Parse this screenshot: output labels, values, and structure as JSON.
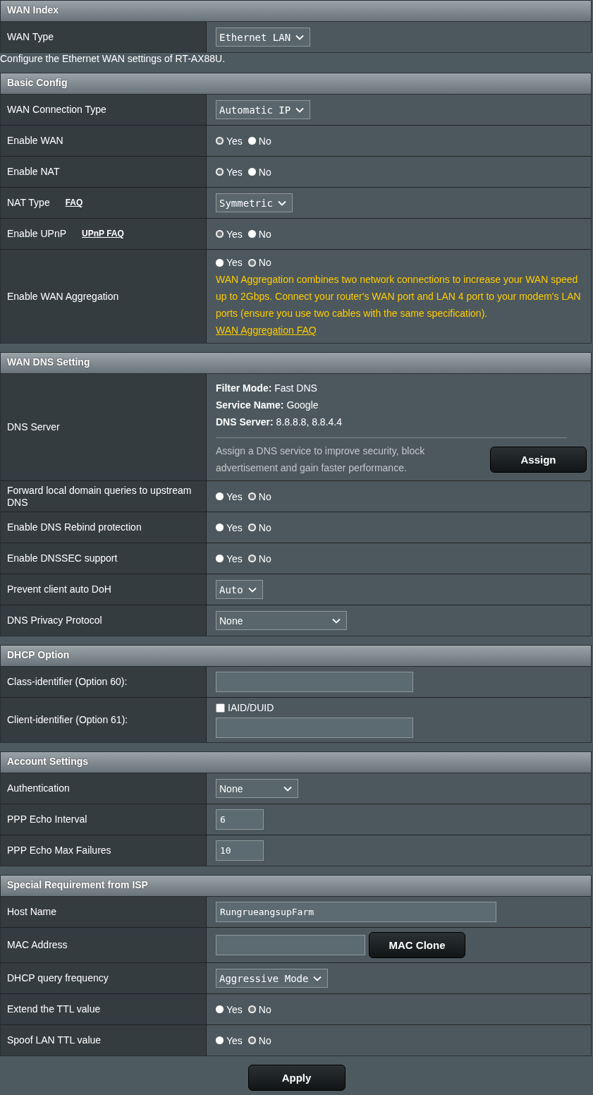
{
  "blocks": [
    {
      "kind": "section",
      "title": "WAN Index",
      "rows": [
        {
          "kind": "select",
          "label": "WAN Type",
          "value": "Ethernet LAN"
        }
      ]
    },
    {
      "kind": "note",
      "text": "Configure the Ethernet WAN settings of RT-AX88U."
    },
    {
      "kind": "section",
      "title": "Basic Config",
      "rows": [
        {
          "kind": "select",
          "label": "WAN Connection Type",
          "value": "Automatic IP"
        },
        {
          "kind": "radio",
          "label": "Enable WAN",
          "options": [
            {
              "label": "Yes",
              "selected": true
            },
            {
              "label": "No",
              "selected": false
            }
          ]
        },
        {
          "kind": "radio",
          "label": "Enable NAT",
          "options": [
            {
              "label": "Yes",
              "selected": true
            },
            {
              "label": "No",
              "selected": false
            }
          ]
        },
        {
          "kind": "select",
          "label": "NAT Type",
          "link": "FAQ",
          "value": "Symmetric"
        },
        {
          "kind": "radio",
          "label": "Enable UPnP",
          "link": "UPnP  FAQ",
          "options": [
            {
              "label": "Yes",
              "selected": true
            },
            {
              "label": "No",
              "selected": false
            }
          ]
        },
        {
          "kind": "radio",
          "label": "Enable WAN Aggregation",
          "options": [
            {
              "label": "Yes",
              "selected": false
            },
            {
              "label": "No",
              "selected": true
            }
          ],
          "note": "WAN Aggregation combines two network connections to increase your WAN speed up to 2Gbps. Connect your router's WAN port and LAN 4 port to your modem's LAN ports (ensure you use two cables with the same specification).",
          "note_link": "WAN Aggregation FAQ"
        }
      ]
    },
    {
      "kind": "section",
      "title": "WAN DNS Setting",
      "rows": [
        {
          "kind": "dns",
          "label": "DNS Server",
          "lines": [
            "**Filter Mode:** Fast DNS",
            "**Service Name:** Google",
            "**DNS Server:** 8.8.8.8, 8.8.4.4"
          ],
          "hint": "Assign a DNS service to improve security, block advertisement and gain faster performance.",
          "button": "Assign"
        },
        {
          "kind": "radio",
          "label": "Forward local domain queries to upstream DNS",
          "options": [
            {
              "label": "Yes",
              "selected": false
            },
            {
              "label": "No",
              "selected": true
            }
          ]
        },
        {
          "kind": "radio",
          "label": "Enable DNS Rebind protection",
          "options": [
            {
              "label": "Yes",
              "selected": false
            },
            {
              "label": "No",
              "selected": true
            }
          ]
        },
        {
          "kind": "radio",
          "label": "Enable DNSSEC support",
          "options": [
            {
              "label": "Yes",
              "selected": false
            },
            {
              "label": "No",
              "selected": true
            }
          ]
        },
        {
          "kind": "select",
          "label": "Prevent client auto DoH",
          "value": "Auto"
        },
        {
          "kind": "wide_select",
          "label": "DNS Privacy Protocol",
          "value": "None"
        }
      ]
    },
    {
      "kind": "section",
      "title": "DHCP Option",
      "rows": [
        {
          "kind": "text",
          "label": "Class-identifier (Option 60):"
        },
        {
          "kind": "check_text",
          "label": "Client-identifier (Option 61):",
          "check_label": "IAID/DUID",
          "checked": false
        }
      ]
    },
    {
      "kind": "section",
      "title": "Account Settings",
      "rows": [
        {
          "kind": "mid_select",
          "label": "Authentication",
          "value": "None"
        },
        {
          "kind": "number",
          "label": "PPP Echo Interval",
          "value": "6"
        },
        {
          "kind": "number",
          "label": "PPP Echo Max Failures",
          "value": "10"
        }
      ]
    },
    {
      "kind": "section",
      "title": "Special Requirement from ISP",
      "rows": [
        {
          "kind": "long_text",
          "label": "Host Name",
          "value": "RungrueangsupFarm"
        },
        {
          "kind": "text_button",
          "label": "MAC Address",
          "button": "MAC Clone"
        },
        {
          "kind": "select",
          "label": "DHCP query frequency",
          "value": "Aggressive Mode"
        },
        {
          "kind": "radio",
          "label": "Extend the TTL value",
          "options": [
            {
              "label": "Yes",
              "selected": false
            },
            {
              "label": "No",
              "selected": true
            }
          ]
        },
        {
          "kind": "radio",
          "label": "Spoof LAN TTL value",
          "options": [
            {
              "label": "Yes",
              "selected": false
            },
            {
              "label": "No",
              "selected": true
            }
          ]
        }
      ]
    }
  ],
  "apply": "Apply"
}
